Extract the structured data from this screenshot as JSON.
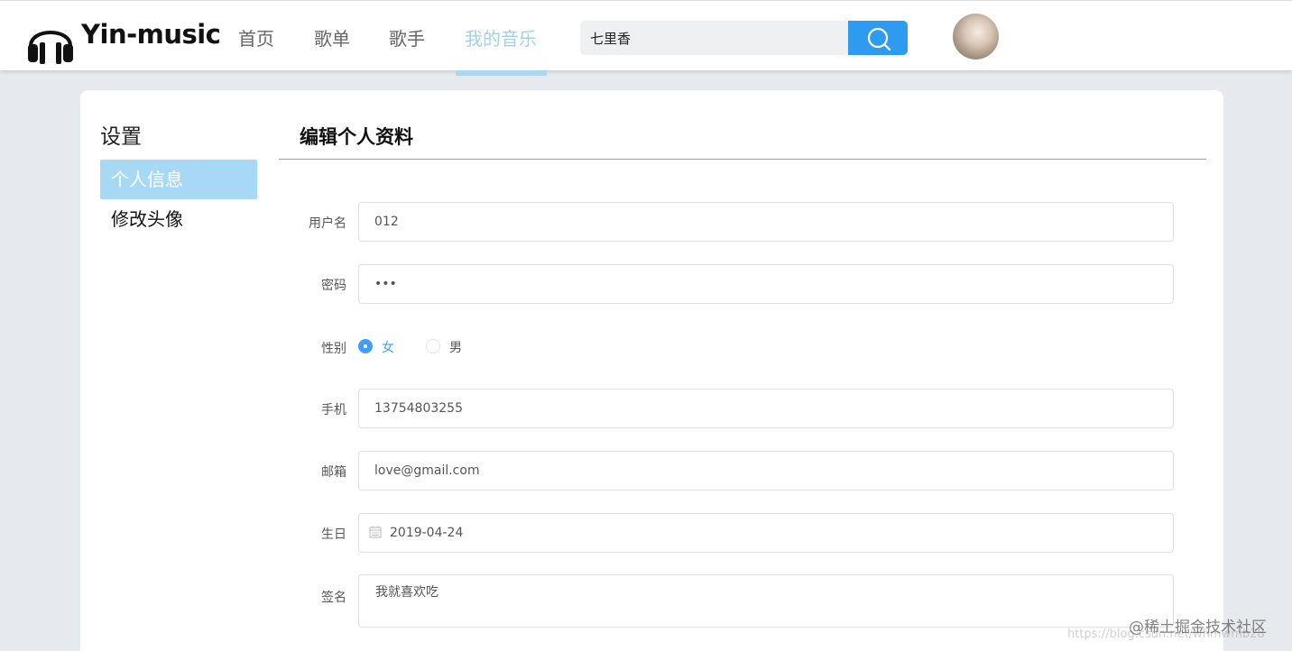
{
  "header": {
    "brand": "Yin-music",
    "logo_icon": "headphones-icon",
    "nav": [
      {
        "label": "首页",
        "active": false
      },
      {
        "label": "歌单",
        "active": false
      },
      {
        "label": "歌手",
        "active": false
      },
      {
        "label": "我的音乐",
        "active": true
      }
    ],
    "search": {
      "value": "七里香",
      "icon": "search-icon"
    },
    "avatar_icon": "user-avatar"
  },
  "sidebar": {
    "title": "设置",
    "items": [
      {
        "label": "个人信息",
        "active": true
      },
      {
        "label": "修改头像",
        "active": false
      }
    ]
  },
  "form": {
    "title": "编辑个人资料",
    "username": {
      "label": "用户名",
      "value": "012"
    },
    "password": {
      "label": "密码",
      "value": "•••"
    },
    "gender": {
      "label": "性别",
      "options": [
        "女",
        "男"
      ],
      "selected": "女"
    },
    "phone": {
      "label": "手机",
      "value": "13754803255"
    },
    "email": {
      "label": "邮箱",
      "value": "love@gmail.com"
    },
    "birthday": {
      "label": "生日",
      "value": "2019-04-24",
      "icon": "calendar-icon"
    },
    "signature": {
      "label": "签名",
      "value": "我就喜欢吃"
    }
  },
  "watermark": {
    "text": "@稀土掘金技术社区",
    "faint_text": "https://blog.csdn.net/whmwmb28"
  },
  "colors": {
    "accent": "#409eff",
    "nav_active": "#9fd0ec",
    "side_active": "#a8d9f4",
    "search_button": "#2d9bf0"
  }
}
